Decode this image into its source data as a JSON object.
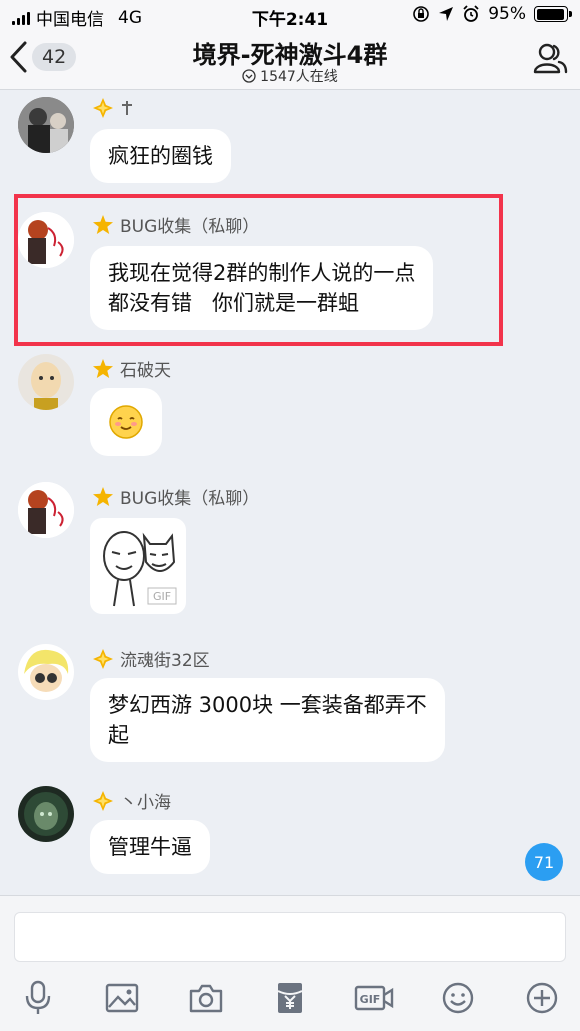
{
  "status_bar": {
    "carrier": "中国电信",
    "network": "4G",
    "time": "下午2:41",
    "battery": "95%",
    "battery_level": 0.95
  },
  "header": {
    "unread_count": "42",
    "title": "境界-死神激斗4群",
    "online_text": "1547人在线"
  },
  "messages": [
    {
      "sender": "",
      "title_icon": "diamond-badge",
      "badge_icon": "cross-icon",
      "text": "疯狂的圈钱"
    },
    {
      "sender": "BUG收集（私聊）",
      "title_icon": "star-badge",
      "text_line1": "我现在觉得2群的制作人说的一点",
      "text_line2": "都没有错   你们就是一群蛆"
    },
    {
      "sender": "石破天",
      "title_icon": "star-badge",
      "emoji": "☺"
    },
    {
      "sender": "BUG收集（私聊）",
      "title_icon": "star-badge",
      "sticker": "GIF"
    },
    {
      "sender": "流魂街32区",
      "title_icon": "diamond-badge",
      "text_line1": "梦幻西游 3000块 一套装备都弄不",
      "text_line2": "起"
    },
    {
      "sender": "丶小海",
      "title_icon": "diamond-badge",
      "text": "管理牛逼"
    }
  ],
  "new_messages_count": "71",
  "toolbar": {
    "items": [
      "mic-icon",
      "image-icon",
      "camera-icon",
      "red-packet-icon",
      "gif-icon",
      "emoji-icon",
      "plus-icon"
    ],
    "gif_label": "GIF"
  },
  "colors": {
    "highlight_border": "#f2334b",
    "accent_blue": "#2b9ef2",
    "badge_gold": "#f5b400"
  }
}
